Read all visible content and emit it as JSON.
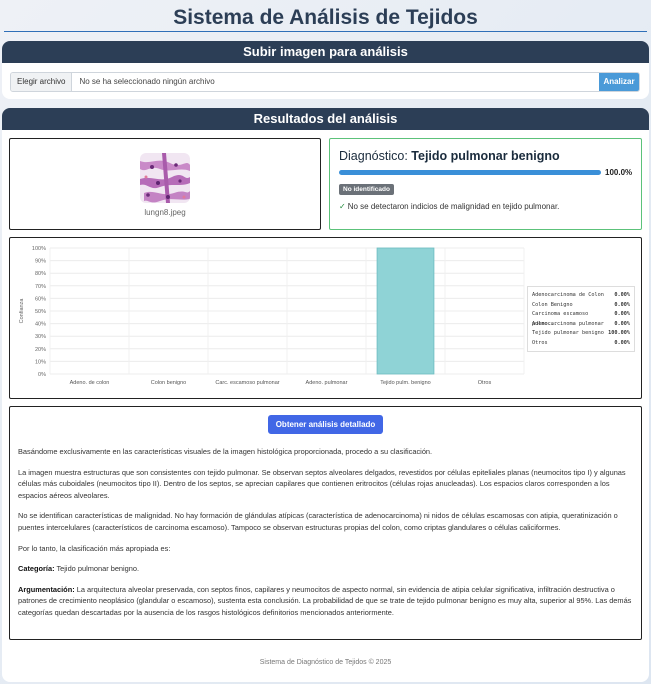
{
  "header": {
    "title": "Sistema de Análisis de Tejidos"
  },
  "upload": {
    "title": "Subir imagen para análisis",
    "choose_label": "Elegir archivo",
    "file_status": "No se ha seleccionado ningún archivo",
    "analyze_label": "Analizar"
  },
  "results": {
    "title": "Resultados del análisis",
    "image_name": "lungn8.jpeg",
    "diagnosis_prefix": "Diagnóstico:",
    "diagnosis_value": "Tejido pulmonar benigno",
    "confidence_pct": 100.0,
    "confidence_label": "100.0%",
    "badge": "No identificado",
    "message": "No se detectaron indicios de malignidad en tejido pulmonar."
  },
  "colors": {
    "accent": "#2c3e56",
    "bar": "#8fd3d6",
    "bar_edge": "#6cbcc0",
    "success": "#5cc27a",
    "progress": "#3a8fd8"
  },
  "icons": {
    "check": "check-icon"
  },
  "chart_data": {
    "type": "bar",
    "categories": [
      "Adeno. de colon",
      "Colon benigno",
      "Carc. escamoso pulmonar",
      "Adeno. pulmonar",
      "Tejido pulm. benigno",
      "Otros"
    ],
    "values": [
      0,
      0,
      0,
      0,
      100,
      0
    ],
    "ylabel": "Confianza",
    "ylim": [
      0,
      100
    ],
    "yticks": [
      "0%",
      "10%",
      "20%",
      "30%",
      "40%",
      "50%",
      "60%",
      "70%",
      "80%",
      "90%",
      "100%"
    ],
    "grid": true,
    "legend": [
      {
        "name": "Adenocarcinoma de Colon",
        "value": "0.00%"
      },
      {
        "name": "Colon Benigno",
        "value": "0.00%"
      },
      {
        "name": "Carcinoma escamoso pulmo...",
        "value": "0.00%"
      },
      {
        "name": "Adenocarcinoma pulmonar",
        "value": "0.00%"
      },
      {
        "name": "Tejido pulmonar benigno",
        "value": "100.00%"
      },
      {
        "name": "Otros",
        "value": "0.00%"
      }
    ],
    "legend_position": "right"
  },
  "detail": {
    "button_label": "Obtener análisis detallado",
    "p1": "Basándome exclusivamente en las características visuales de la imagen histológica proporcionada, procedo a su clasificación.",
    "p2": "La imagen muestra estructuras que son consistentes con tejido pulmonar. Se observan septos alveolares delgados, revestidos por células epiteliales planas (neumocitos tipo I) y algunas células más cuboidales (neumocitos tipo II). Dentro de los septos, se aprecian capilares que contienen eritrocitos (células rojas anucleadas). Los espacios claros corresponden a los espacios aéreos alveolares.",
    "p3": "No se identifican características de malignidad. No hay formación de glándulas atípicas (característica de adenocarcinoma) ni nidos de células escamosas con atipia, queratinización o puentes intercelulares (característicos de carcinoma escamoso). Tampoco se observan estructuras propias del colon, como criptas glandulares o células caliciformes.",
    "p4": "Por lo tanto, la clasificación más apropiada es:",
    "cat_label": "Categoría:",
    "cat_value": "Tejido pulmonar benigno.",
    "arg_label": "Argumentación:",
    "arg_value": "La arquitectura alveolar preservada, con septos finos, capilares y neumocitos de aspecto normal, sin evidencia de atipia celular significativa, infiltración destructiva o patrones de crecimiento neoplásico (glandular o escamoso), sustenta esta conclusión. La probabilidad de que se trate de tejido pulmonar benigno es muy alta, superior al 95%. Las demás categorías quedan descartadas por la ausencia de los rasgos histológicos definitorios mencionados anteriormente."
  },
  "footer": {
    "text": "Sistema de Diagnóstico de Tejidos © 2025"
  }
}
